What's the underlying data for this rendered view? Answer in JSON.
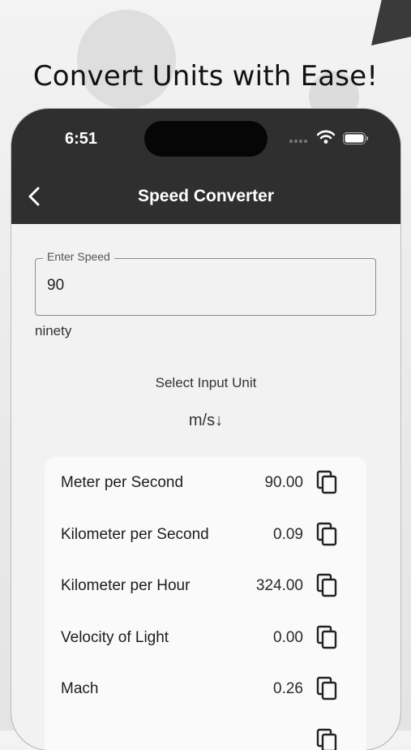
{
  "headline": "Convert Units with Ease!",
  "status": {
    "time": "6:51"
  },
  "app_bar": {
    "title": "Speed Converter"
  },
  "speed_field": {
    "label": "Enter Speed",
    "value": "90"
  },
  "number_words": "ninety",
  "select_unit": {
    "label": "Select Input Unit",
    "value": "m/s↓"
  },
  "results": [
    {
      "unit": "Meter per Second",
      "value": "90.00"
    },
    {
      "unit": "Kilometer per Second",
      "value": "0.09"
    },
    {
      "unit": "Kilometer per Hour",
      "value": "324.00"
    },
    {
      "unit": "Velocity of Light",
      "value": "0.00"
    },
    {
      "unit": "Mach",
      "value": "0.26"
    }
  ],
  "icons": {
    "back": "chevron-left-icon",
    "copy": "copy-icon",
    "wifi": "wifi-icon",
    "battery": "battery-icon"
  },
  "colors": {
    "app_bar": "#2f2f2f",
    "content": "#f2f2f2",
    "card": "#fafafa"
  }
}
